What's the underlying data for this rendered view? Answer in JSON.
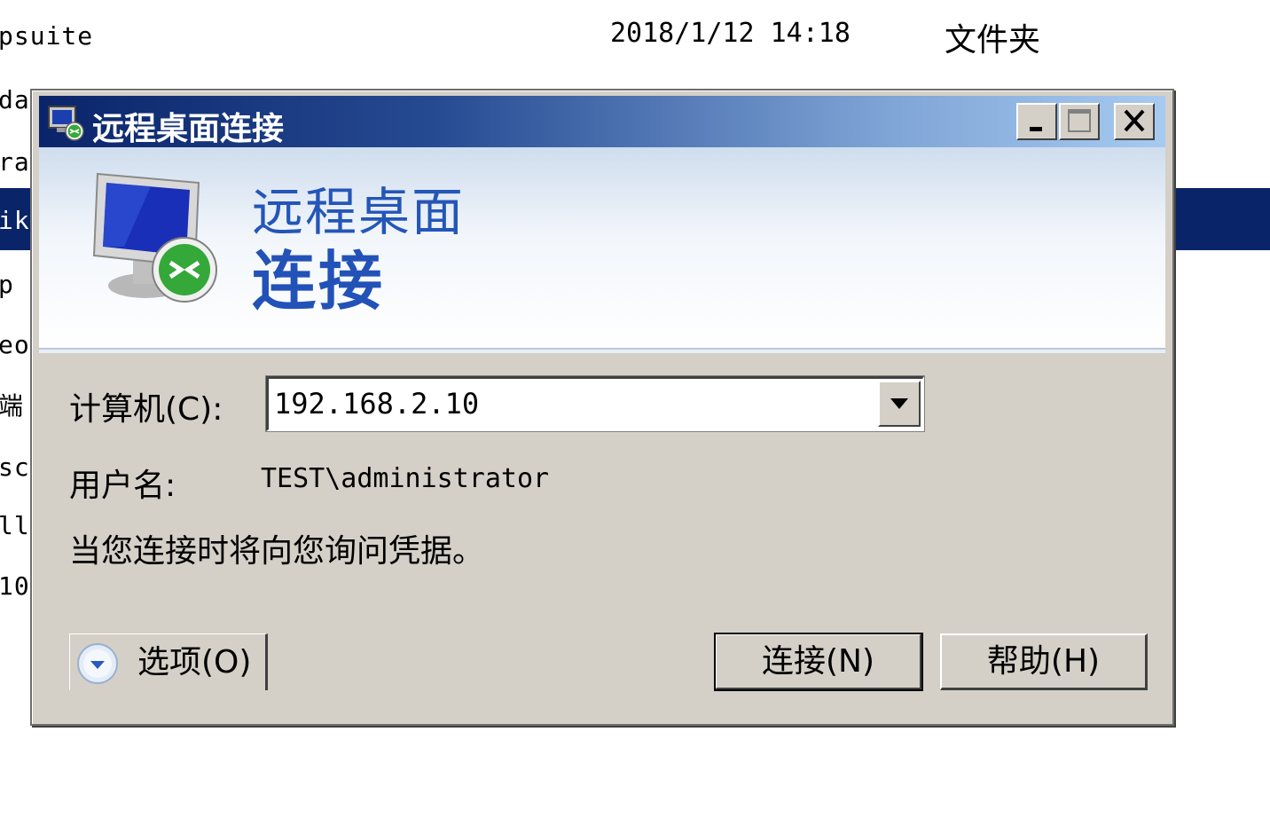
{
  "background_list": {
    "rows": [
      {
        "name": "psuite",
        "date": "2018/1/12 14:18",
        "type": "文件夹"
      },
      {
        "name": "da",
        "date": "",
        "type": ""
      },
      {
        "name": "ra",
        "date": "",
        "type": ""
      },
      {
        "name": "ik",
        "date": "",
        "type": ""
      },
      {
        "name": "p",
        "date": "",
        "type": ""
      },
      {
        "name": "eo:",
        "date": "",
        "type": ""
      },
      {
        "name": "端",
        "date": "",
        "type": ""
      },
      {
        "name": "sc",
        "date": "",
        "type": ""
      },
      {
        "name": "ll",
        "date": "",
        "type": ""
      },
      {
        "name": "10",
        "date": "",
        "type": ""
      }
    ]
  },
  "dialog": {
    "title": "远程桌面连接",
    "banner": {
      "line1": "远程桌面",
      "line2": "连接"
    },
    "computer_label": "计算机(C):",
    "computer_value": "192.168.2.10",
    "username_label": "用户名:",
    "username_value": "TEST\\administrator",
    "note": "当您连接时将向您询问凭据。",
    "options_button": "选项(O)",
    "connect_button": "连接(N)",
    "help_button": "帮助(H)"
  },
  "colors": {
    "titlebar_start": "#0a246a",
    "titlebar_end": "#a6caf0",
    "dialog_face": "#d4d0c8",
    "banner_text": "#2456b8",
    "selected_row": "#0a246a"
  },
  "icons": [
    "remote-desktop-icon",
    "minimize-icon",
    "maximize-icon",
    "close-icon",
    "monitor-connect-icon",
    "dropdown-arrow-icon",
    "expand-options-icon"
  ]
}
